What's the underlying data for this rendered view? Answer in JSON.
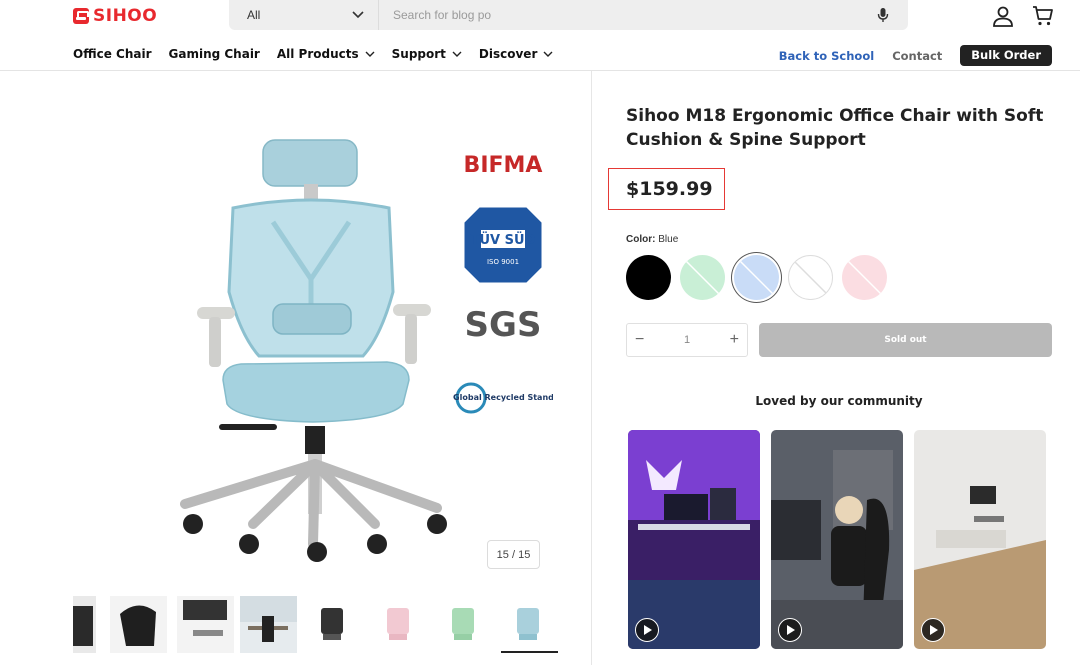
{
  "brand": {
    "name": "SIHOO",
    "color": "#e8292e"
  },
  "search": {
    "category": "All",
    "placeholder": "Search for blog po"
  },
  "nav": {
    "items": [
      "Office Chair",
      "Gaming Chair",
      "All Products",
      "Support",
      "Discover"
    ],
    "right": {
      "back_to_school": "Back to School",
      "contact": "Contact",
      "bulk_order": "Bulk Order"
    }
  },
  "gallery": {
    "counter": "15 / 15",
    "certifications": [
      "BIFMA",
      "TÜV SÜD",
      "ISO 9001",
      "SGS",
      "Global Recycled Standard"
    ]
  },
  "product": {
    "title": "Sihoo M18 Ergonomic Office Chair with Soft Cushion & Spine Support",
    "price": "$159.99",
    "color_label": "Color:",
    "color_value": "Blue",
    "swatches": [
      {
        "name": "Black",
        "color": "#000000",
        "available": true
      },
      {
        "name": "Green",
        "color": "#c9efd6",
        "available": false
      },
      {
        "name": "Blue",
        "color": "#c9dcf7",
        "available": false,
        "selected": true
      },
      {
        "name": "White",
        "color": "#ffffff",
        "available": false
      },
      {
        "name": "Pink",
        "color": "#fbdde2",
        "available": false
      }
    ],
    "quantity": "1",
    "sold_out_label": "Sold out"
  },
  "community": {
    "heading": "Loved by our community"
  },
  "colors": {
    "accent_blue": "#2f63b8",
    "price_highlight": "#e53935",
    "sold_out": "#b9b9b9"
  }
}
